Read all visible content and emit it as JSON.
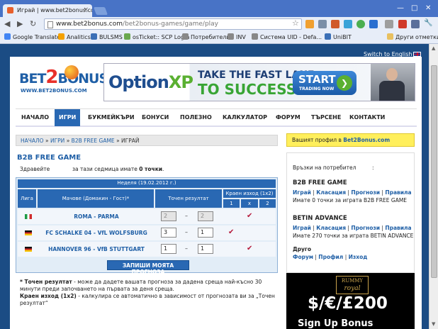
{
  "browser": {
    "tab_title": "Играй | www.bet2bonus.co",
    "tab_close": "×",
    "min_glyph": "—",
    "max_glyph": "□",
    "close_glyph": "✕",
    "back_glyph": "◀",
    "forward_glyph": "▶",
    "reload_glyph": "↻",
    "url_host": "www.bet2bonus.com",
    "url_path": "/bet2bonus-games/game/play",
    "star_glyph": "☆",
    "wrench_glyph": "🔧",
    "bookmarks": [
      {
        "label": "Google Translate",
        "color": "#4285f4"
      },
      {
        "label": "Analitics",
        "color": "#f4a100"
      },
      {
        "label": "BULSMS",
        "color": "#3b6fb6"
      },
      {
        "label": "osTicket:: SCP Login",
        "color": "#6aa84f"
      },
      {
        "label": "Потребители",
        "color": "#888888"
      },
      {
        "label": "INV",
        "color": "#888888"
      },
      {
        "label": "Система UID - Defa...",
        "color": "#888888"
      },
      {
        "label": "UniBIT",
        "color": "#3b6fb6"
      }
    ],
    "other_bookmarks": "Други отметки"
  },
  "site": {
    "switch_lang": "Switch to English",
    "logo_word_a": "BET",
    "logo_word_b": "2",
    "logo_word_c": "BONUS",
    "logo_url": "WWW.BET2BONUS.COM",
    "banner": {
      "brand_a": "Option",
      "brand_b": "XP",
      "line1": "TAKE THE FAST LANE",
      "line2": "TO SUCCESS",
      "btn_big": "START",
      "btn_small": "TRADING NOW",
      "btn_arrow": "❯"
    },
    "nav": [
      "НАЧАЛО",
      "ИГРИ",
      "БУКМЕЙКЪРИ",
      "БОНУСИ",
      "ПОЛЕЗНО",
      "КАЛКУЛАТОР",
      "ФОРУМ",
      "ТЪРСЕНЕ",
      "КОНТАКТИ"
    ],
    "breadcrumbs": {
      "home": "НАЧАЛО",
      "games": "ИГРИ",
      "b2b": "B2B FREE GAME",
      "current": "ИГРАЙ",
      "sep": "»"
    },
    "profile_text": "Вашият профил в ",
    "profile_link": "Bet2Bonus.com"
  },
  "game": {
    "title": "B2B FREE GAME",
    "hello": "Здравейте",
    "week_text": "за тази седмица имате ",
    "week_points": "0 точки",
    "week_end": ".",
    "week_label": "Неделя (19.02.2012 г.)",
    "headers": {
      "league": "Лига",
      "matches": "Мачове (Домакин - Гост)*",
      "exact": "Точен резултат",
      "final": "Краен изход (1x2)",
      "one": "1",
      "x": "x",
      "two": "2"
    },
    "dash": "–",
    "check_glyph": "✔",
    "rows": [
      {
        "teams": "ROMA - PARMA",
        "home": "2",
        "away": "2",
        "disabled": true,
        "pick": "x",
        "flag": "it"
      },
      {
        "teams": "FC SCHALKE 04 - VfL WOLFSBURG",
        "home": "3",
        "away": "1",
        "disabled": false,
        "pick": "1",
        "flag": "de"
      },
      {
        "teams": "HANNOVER 96 - VfB STUTTGART",
        "home": "1",
        "away": "1",
        "disabled": false,
        "pick": "x",
        "flag": "de"
      }
    ],
    "submit": "ЗАПИШИ МОЯТА ПРОГНОЗА",
    "note1_label": "* Точен резултат",
    "note1_text": " - може да дадете вашата прогноза за дадена среща най-късно 30 минути преди започването на първата за деня среща.",
    "note2_label": "Краен изход (1x2)",
    "note2_text": " - калкулира се автоматично в зависимост от прогнозата ви за „Точен резултат“"
  },
  "sidebar": {
    "user_link": "Връзки на потребител",
    "colon": ":",
    "g1_title": "B2B FREE GAME",
    "g2_title": "BETIN ADVANCE",
    "play": "Играй",
    "standings": "Класация",
    "forecasts": "Прогнози",
    "rules": "Правила",
    "sep": "|",
    "g1_info": "Имате 0 точки за играта B2B FREE GAME",
    "g2_info": "Имате 270 точки за играта BETIN ADVANCE",
    "other": "Друго",
    "forum": "Форум",
    "profile": "Профил",
    "exit": "Изход"
  },
  "ad": {
    "rummy_a": "RUMMY",
    "rummy_b": "royal",
    "money": "$/€/£200",
    "signup": "Sign Up Bonus"
  }
}
